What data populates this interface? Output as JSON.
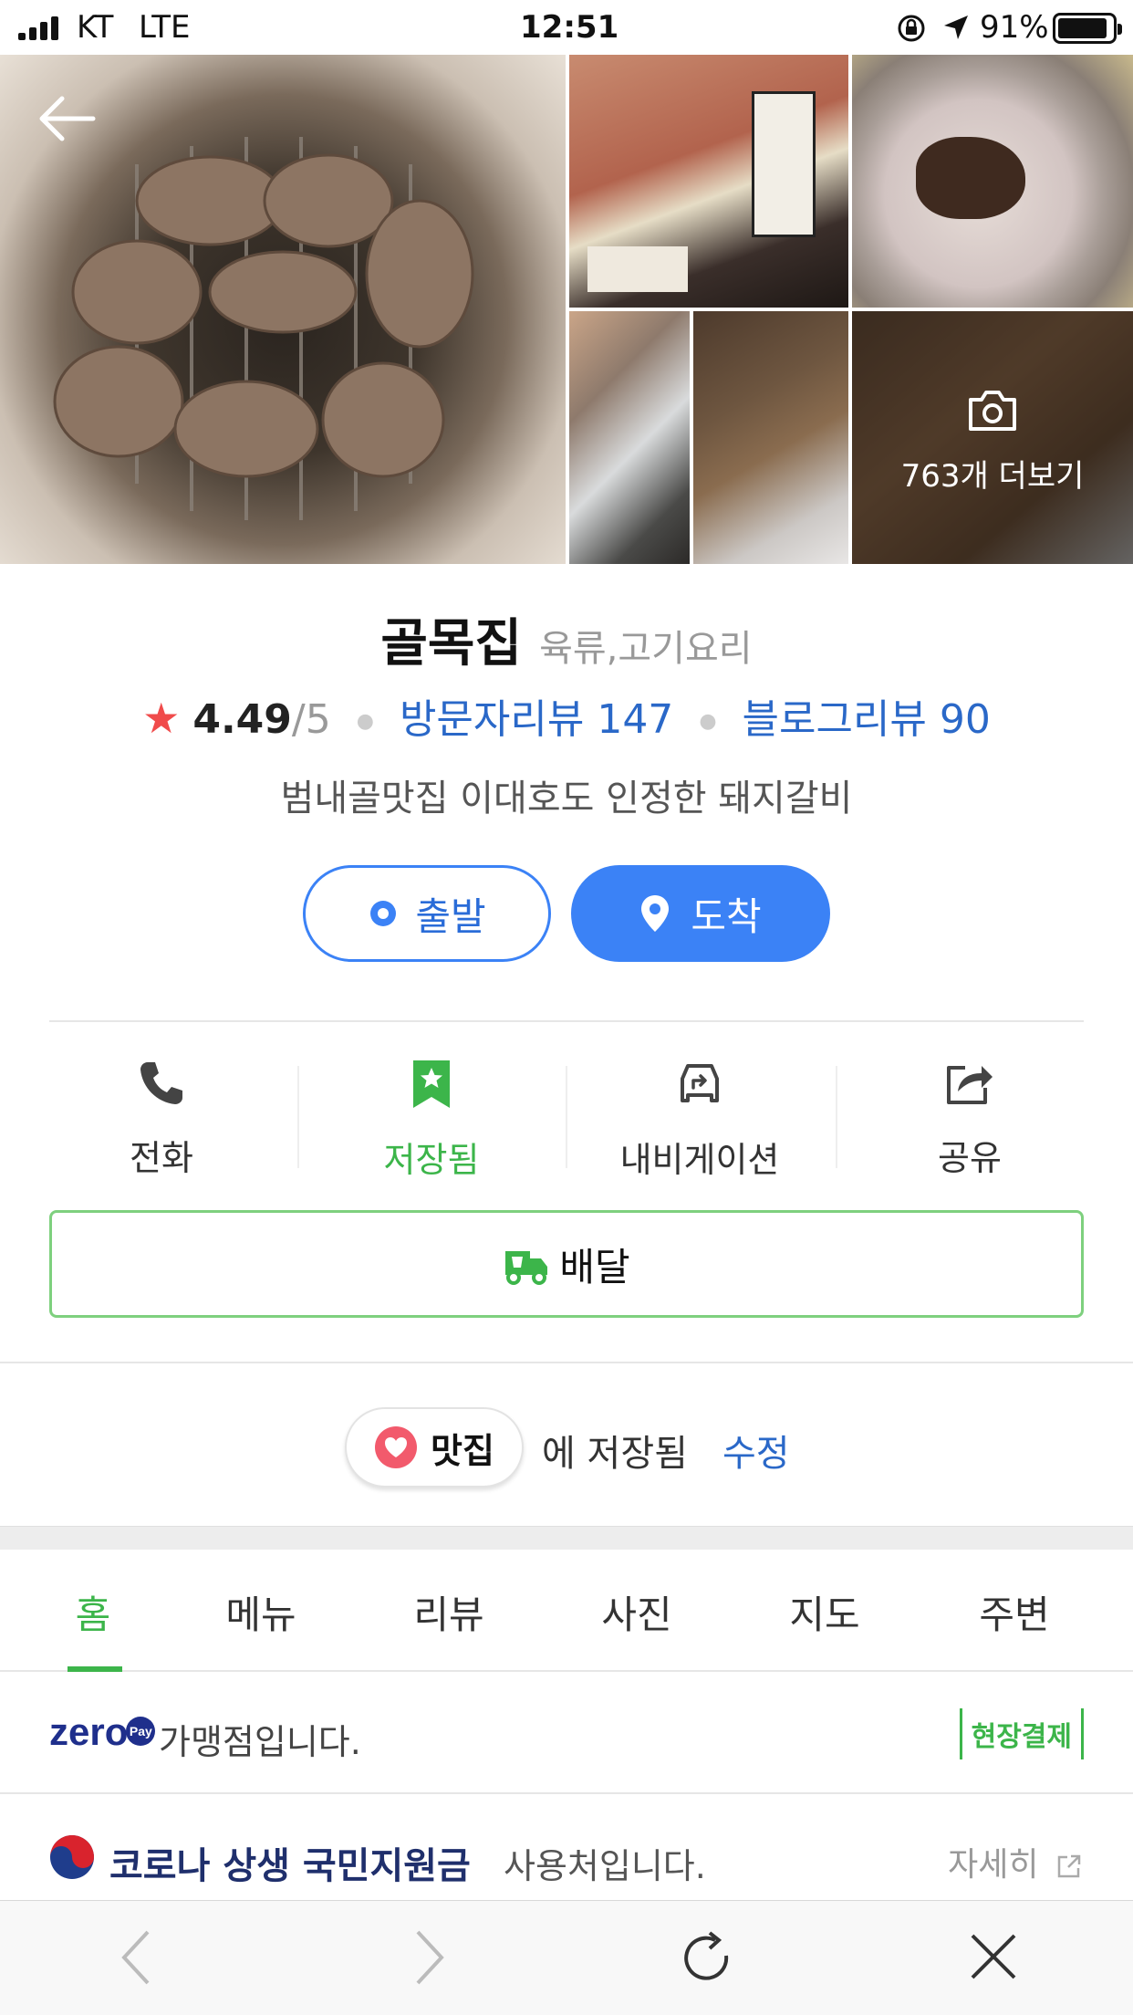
{
  "status_bar": {
    "carrier": "KT",
    "network": "LTE",
    "time": "12:51",
    "battery": "91%",
    "battery_level": 0.91
  },
  "photos": {
    "more_label": "763개 더보기"
  },
  "place": {
    "name": "골목집",
    "category": "육류,고기요리",
    "rating": "4.49",
    "rating_max": "/5",
    "visitor_reviews": "방문자리뷰 147",
    "blog_reviews": "블로그리뷰 90",
    "description": "범내골맛집 이대호도 인정한 돼지갈비"
  },
  "route": {
    "start_label": "출발",
    "end_label": "도착"
  },
  "actions": [
    {
      "label": "전화",
      "icon": "phone-icon"
    },
    {
      "label": "저장됨",
      "icon": "bookmark-star-icon"
    },
    {
      "label": "내비게이션",
      "icon": "navigation-car-icon"
    },
    {
      "label": "공유",
      "icon": "share-icon"
    }
  ],
  "delivery": {
    "label": "배달",
    "icon": "delivery-truck-icon"
  },
  "saved": {
    "folder": "맛집",
    "text": "에 저장됨",
    "edit": "수정"
  },
  "tabs": [
    "홈",
    "메뉴",
    "리뷰",
    "사진",
    "지도",
    "주변"
  ],
  "active_tab": "홈",
  "zeropay": {
    "logo": "zero",
    "logo_badge": "Pay",
    "text": "가맹점입니다.",
    "tag": "현장결제"
  },
  "corona": {
    "title": "코로나 상생 국민지원금",
    "text": "사용처입니다.",
    "more": "자세히"
  },
  "colors": {
    "accent_blue": "#3b82f6",
    "link_blue": "#2a68c8",
    "green": "#3cb54a",
    "star_red": "#f04b4b"
  }
}
